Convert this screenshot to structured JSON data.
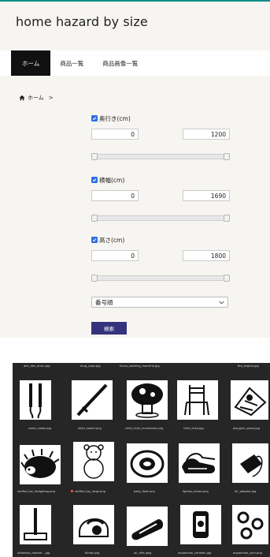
{
  "site": {
    "title": "home hazard by size"
  },
  "nav": [
    {
      "label": "ホーム",
      "active": true
    },
    {
      "label": "商品一覧",
      "active": false
    },
    {
      "label": "商品画像一覧",
      "active": false
    }
  ],
  "breadcrumb": {
    "home": "ホーム",
    "separator": ">"
  },
  "filters": [
    {
      "label": "奥行き(cm)",
      "checked": true,
      "min": "0",
      "max": "1200"
    },
    {
      "label": "横幅(cm)",
      "checked": true,
      "min": "0",
      "max": "1690"
    },
    {
      "label": "高さ(cm)",
      "checked": true,
      "min": "0",
      "max": "1800"
    }
  ],
  "sort": {
    "selected": "番号順"
  },
  "search_button": "検索",
  "gallery": {
    "top_row": [
      "den_den_drum.jpg",
      "drug_cage.jpg",
      "Drum_washing_machine.jpg",
      "fire_engine.jpg"
    ],
    "rows": [
      [
        "noise_maker.jpg",
        "short_sword.png",
        "child_chair_mushroom.png",
        "child_chair.jpg",
        "playgym_piano.jpg"
      ],
      [
        "stuffed_toy_hedgehog.png",
        "stuffed_toy_large.png",
        "baby_float.png",
        "lightup_shoes.png",
        "AC_adapter.jpg"
      ],
      [
        "Adhesive_cleaner....jpg",
        "Kimet.png",
        "air_rifle.jpeg",
        "anpanman_canteen.jpg",
        "anpanman_corn.png"
      ]
    ],
    "marker_color": "#ff5a4e"
  },
  "colors": {
    "accent_bar": "#0c8f86",
    "button": "#34337c",
    "checkbox": "#2c6fe4",
    "nav_active": "#111111"
  }
}
